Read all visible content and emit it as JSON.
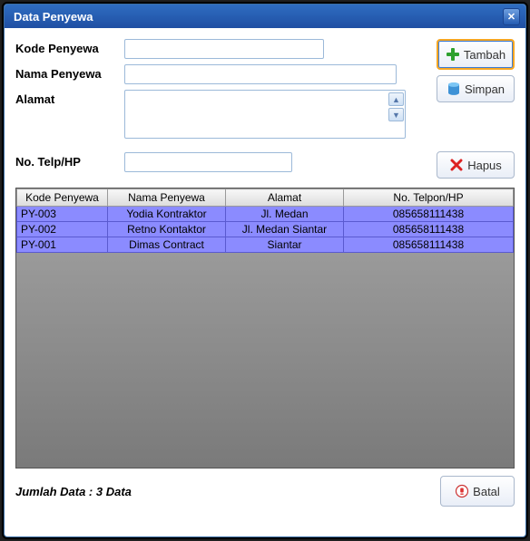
{
  "window": {
    "title": "Data Penyewa"
  },
  "form": {
    "kode_label": "Kode Penyewa",
    "nama_label": "Nama Penyewa",
    "alamat_label": "Alamat",
    "telp_label": "No. Telp/HP",
    "kode_value": "",
    "nama_value": "",
    "alamat_value": "",
    "telp_value": ""
  },
  "buttons": {
    "tambah": "Tambah",
    "simpan": "Simpan",
    "hapus": "Hapus",
    "batal": "Batal"
  },
  "table": {
    "headers": {
      "kode": "Kode Penyewa",
      "nama": "Nama Penyewa",
      "alamat": "Alamat",
      "telp": "No. Telpon/HP"
    },
    "rows": [
      {
        "kode": "PY-003",
        "nama": "Yodia Kontraktor",
        "alamat": "Jl. Medan",
        "telp": "085658111438"
      },
      {
        "kode": "PY-002",
        "nama": "Retno Kontaktor",
        "alamat": "Jl. Medan Siantar",
        "telp": "085658111438"
      },
      {
        "kode": "PY-001",
        "nama": "Dimas Contract",
        "alamat": "Siantar",
        "telp": "085658111438"
      }
    ]
  },
  "footer": {
    "count_text": "Jumlah Data : 3 Data"
  }
}
